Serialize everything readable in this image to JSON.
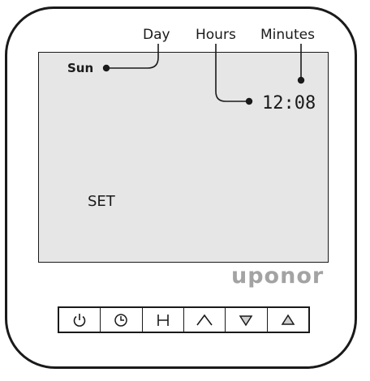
{
  "labels": {
    "day": "Day",
    "hours": "Hours",
    "minutes": "Minutes"
  },
  "display": {
    "day": "Sun",
    "time": "12:08",
    "mode": "SET"
  },
  "brand": "uponor",
  "buttons": [
    {
      "icon": "power-icon"
    },
    {
      "icon": "clock-icon"
    },
    {
      "icon": "h-icon"
    },
    {
      "icon": "chevron-up-icon"
    },
    {
      "icon": "triangle-down-icon"
    },
    {
      "icon": "triangle-up-icon"
    }
  ],
  "colors": {
    "screen": "#e6e6e6",
    "outline": "#1a1a1a",
    "brand": "#a3a3a3"
  }
}
